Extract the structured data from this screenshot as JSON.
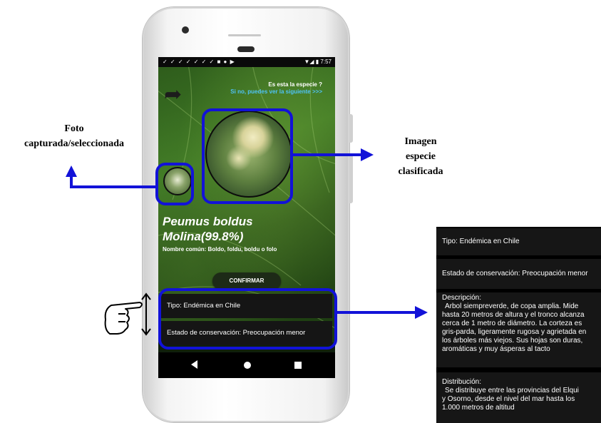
{
  "status_bar": {
    "time": "7:57"
  },
  "screen": {
    "question_line1": "Es esta la especie ?",
    "question_line2": "Si no, puedes ver la siguiente >>>",
    "species_line1": "Peumus boldus",
    "species_line2": "Molina(99.8%)",
    "common_name": "Nombre común: Boldo, foldu, boldu o folo",
    "confirm_label": "CONFIRMAR",
    "info": [
      {
        "label": "Tipo: Endémica en Chile"
      },
      {
        "label": "Estado de conservación: Preocupación menor"
      }
    ]
  },
  "annotations": {
    "photo_line1": "Foto",
    "photo_line2": "capturada/seleccionada",
    "species_img_line1": "Imagen",
    "species_img_line2": "especie",
    "species_img_line3": "clasificada"
  },
  "zoom_panel": {
    "tipo": "Tipo: Endémica en Chile",
    "estado": "Estado de conservación: Preocupación menor",
    "descripcion_title": "Descripción:",
    "descripcion_lines": [
      "Arbol siempreverde, de copa amplia. Mide",
      "hasta 20 metros de altura y el tronco alcanza",
      "cerca de 1 metro de diámetro. La corteza es",
      "gris-parda, ligeramente rugosa y agrietada en",
      "los árboles más viejos. Sus hojas son duras,",
      "aromáticas y muy ásperas al tacto"
    ],
    "distribucion_title": "Distribución:",
    "distribucion_lines": [
      "Se distribuye entre las provincias del Elqui",
      "y Osorno, desde el nivel del mar hasta los",
      "1.000 metros de altitud"
    ]
  },
  "colors": {
    "highlight": "#1212d8",
    "link": "#4fc3f7"
  }
}
